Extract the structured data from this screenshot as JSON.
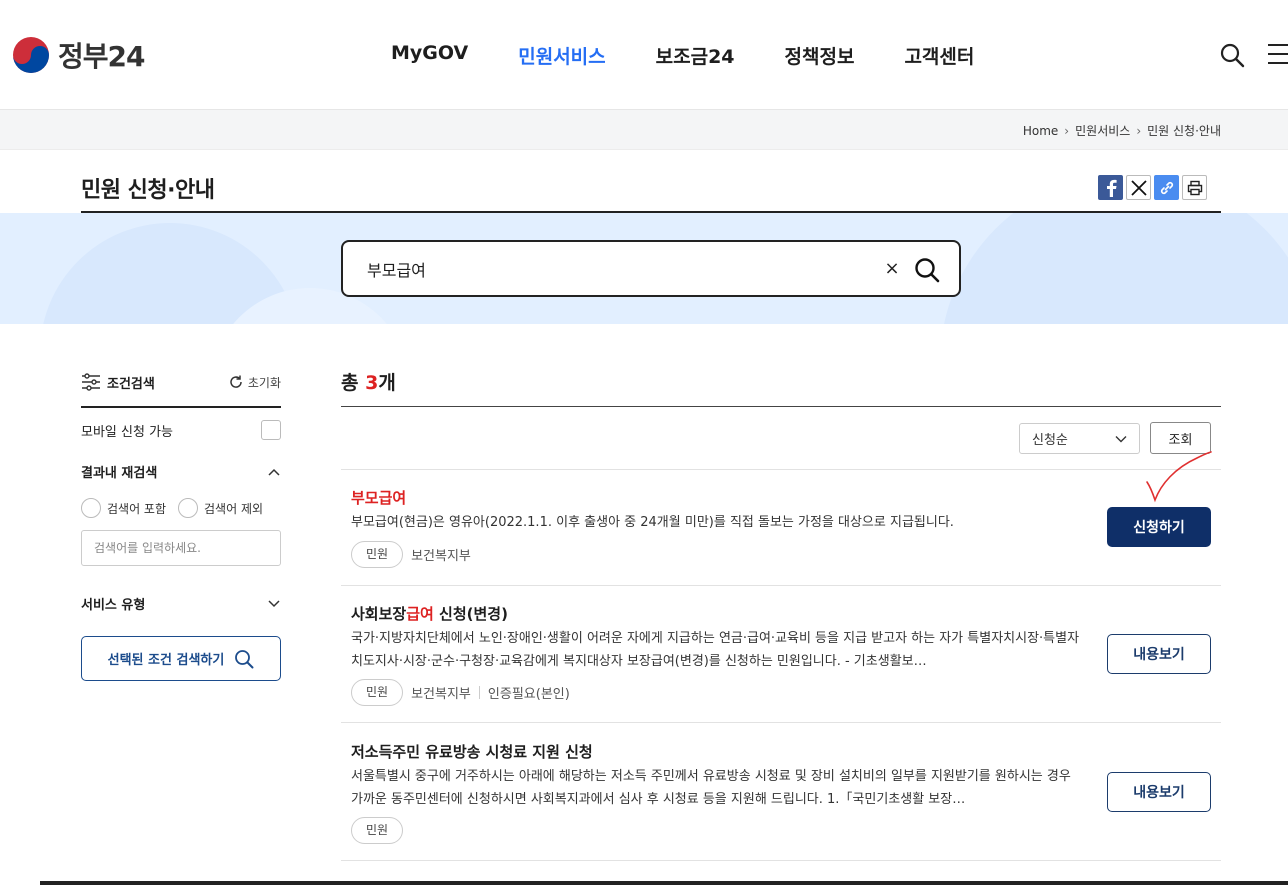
{
  "header": {
    "logo_text": "정부24",
    "nav": [
      "MyGOV",
      "민원서비스",
      "보조금24",
      "정책정보",
      "고객센터"
    ],
    "active_nav": "민원서비스"
  },
  "breadcrumb": [
    "Home",
    "민원서비스",
    "민원 신청·안내"
  ],
  "page": {
    "title": "민원 신청·안내"
  },
  "search": {
    "value": "부모급여",
    "clear_icon": "×"
  },
  "sidebar": {
    "filter_label": "조건검색",
    "reset_label": "초기화",
    "mobile_label": "모바일 신청 가능",
    "refine_label": "결과내 재검색",
    "include_label": "검색어 포함",
    "exclude_label": "검색어 제외",
    "keyword_placeholder": "검색어를 입력하세요.",
    "service_type_label": "서비스 유형",
    "submit_label": "선택된 조건 검색하기"
  },
  "results": {
    "total_prefix": "총 ",
    "total_count": "3",
    "total_suffix": "개",
    "sort_value": "신청순",
    "sort_button": "조회",
    "items": [
      {
        "title_pre": "",
        "title_hl": "부모급여",
        "title_post": "",
        "desc": "부모급여(현금)은 영유아(2022.1.1. 이후 출생아 중 24개월 미만)를 직접 돌보는 가정을 대상으로 지급됩니다.",
        "tag": "민원",
        "org": "보건복지부",
        "auth": "",
        "action": "신청하기"
      },
      {
        "title_pre": "사회보장",
        "title_hl": "급여",
        "title_post": " 신청(변경)",
        "desc": "국가·지방자치단체에서 노인·장애인·생활이 어려운 자에게 지급하는 연금·급여·교육비 등을 지급 받고자 하는 자가 특별자치시장·특별자치도지사·시장·군수·구청장·교육감에게 복지대상자 보장급여(변경)를 신청하는 민원입니다. - 기초생활보…",
        "tag": "민원",
        "org": "보건복지부",
        "auth": "인증필요(본인)",
        "action": "내용보기"
      },
      {
        "title_pre": "저소득주민 유료방송 시청료 지원 신청",
        "title_hl": "",
        "title_post": "",
        "desc": "서울특별시 중구에 거주하시는 아래에 해당하는 저소득 주민께서 유료방송 시청료 및 장비 설치비의 일부를 지원받기를 원하시는 경우 가까운 동주민센터에 신청하시면 사회복지과에서 심사 후 시청료 등을 지원해 드립니다. 1.「국민기초생활 보장…",
        "tag": "민원",
        "org": "",
        "auth": "",
        "action": "내용보기"
      }
    ]
  },
  "colors": {
    "accent": "#256ef4",
    "highlight": "#dd2222",
    "primary_button": "#0f2f68",
    "band": "#e2efff"
  }
}
